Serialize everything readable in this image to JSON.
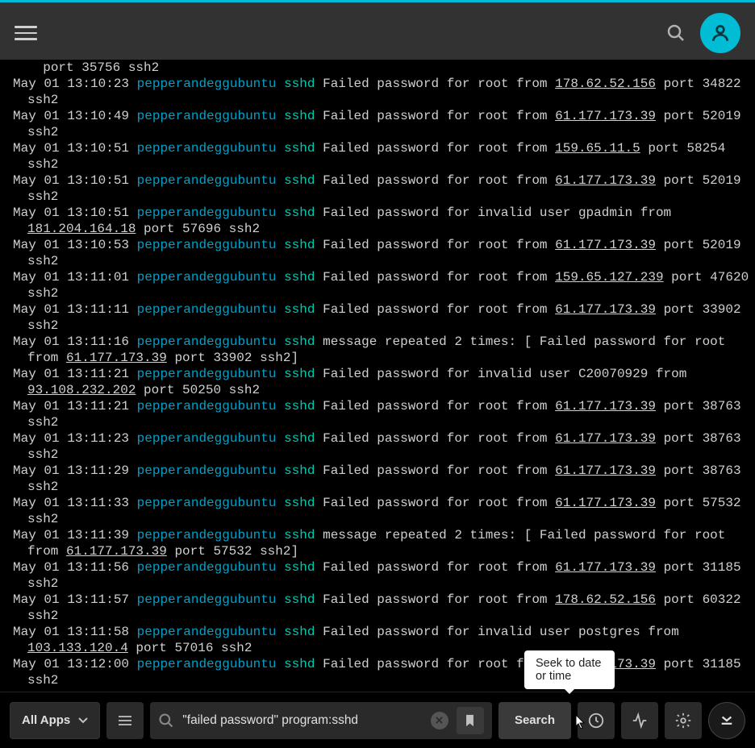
{
  "tooltip": {
    "seek": "Seek to date or time"
  },
  "bottom": {
    "app_select": "All Apps",
    "search_value": "\"failed password\" program:sshd",
    "search_button": "Search"
  },
  "log": {
    "host": "pepperandeggubuntu",
    "prog": "sshd",
    "lines": [
      {
        "type": "partial_top",
        "text2": " port 35756 ssh2"
      },
      {
        "ts": "May 01 13:10:23",
        "msg1": "Failed password for root from ",
        "ip": "178.62.52.156",
        "msg2": " port 34822 ssh2"
      },
      {
        "ts": "May 01 13:10:49",
        "msg1": "Failed password for root from ",
        "ip": "61.177.173.39",
        "msg2": " port 52019 ssh2"
      },
      {
        "ts": "May 01 13:10:51",
        "msg1": "Failed password for root from ",
        "ip": "159.65.11.5",
        "msg2": " port 58254 ssh2"
      },
      {
        "ts": "May 01 13:10:51",
        "msg1": "Failed password for root from ",
        "ip": "61.177.173.39",
        "msg2": " port 52019 ssh2"
      },
      {
        "ts": "May 01 13:10:51",
        "msg1": "Failed password for invalid user gpadmin from ",
        "ip": "181.204.164.18",
        "msg2": " port 57696 ssh2"
      },
      {
        "ts": "May 01 13:10:53",
        "msg1": "Failed password for root from ",
        "ip": "61.177.173.39",
        "msg2": " port 52019 ssh2"
      },
      {
        "ts": "May 01 13:11:01",
        "msg1": "Failed password for root from ",
        "ip": "159.65.127.239",
        "msg2": " port 47620 ssh2"
      },
      {
        "ts": "May 01 13:11:11",
        "msg1": "Failed password for root from ",
        "ip": "61.177.173.39",
        "msg2": " port 33902 ssh2"
      },
      {
        "ts": "May 01 13:11:16",
        "msg1": "message repeated 2 times: [ Failed password for root from ",
        "ip": "61.177.173.39",
        "msg2": " port 33902 ssh2]"
      },
      {
        "ts": "May 01 13:11:21",
        "msg1": "Failed password for invalid user C20070929 from ",
        "ip": "93.108.232.202",
        "msg2": " port 50250 ssh2"
      },
      {
        "ts": "May 01 13:11:21",
        "msg1": "Failed password for root from ",
        "ip": "61.177.173.39",
        "msg2": " port 38763 ssh2"
      },
      {
        "ts": "May 01 13:11:23",
        "msg1": "Failed password for root from ",
        "ip": "61.177.173.39",
        "msg2": " port 38763 ssh2"
      },
      {
        "ts": "May 01 13:11:29",
        "msg1": "Failed password for root from ",
        "ip": "61.177.173.39",
        "msg2": " port 38763 ssh2"
      },
      {
        "ts": "May 01 13:11:33",
        "msg1": "Failed password for root from ",
        "ip": "61.177.173.39",
        "msg2": " port 57532 ssh2"
      },
      {
        "ts": "May 01 13:11:39",
        "msg1": "message repeated 2 times: [ Failed password for root from ",
        "ip": "61.177.173.39",
        "msg2": " port 57532 ssh2]"
      },
      {
        "ts": "May 01 13:11:56",
        "msg1": "Failed password for root from ",
        "ip": "61.177.173.39",
        "msg2": " port 31185 ssh2"
      },
      {
        "ts": "May 01 13:11:57",
        "msg1": "Failed password for root from ",
        "ip": "178.62.52.156",
        "msg2": " port 60322 ssh2"
      },
      {
        "ts": "May 01 13:11:58",
        "msg1": "Failed password for invalid user postgres from ",
        "ip": "103.133.120.4",
        "msg2": " port 57016 ssh2"
      },
      {
        "ts": "May 01 13:12:00",
        "msg1": "Failed password for root from ",
        "ip": "61.177.173.39",
        "msg2": " port 31185 ssh2"
      }
    ]
  }
}
